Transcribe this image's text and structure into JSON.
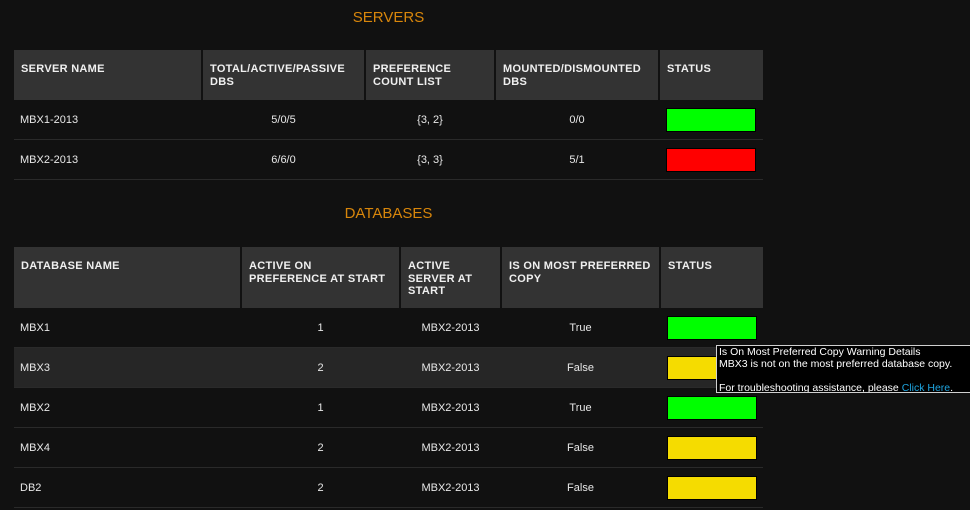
{
  "colors": {
    "accent": "#d8860b",
    "status_green": "#00ff00",
    "status_red": "#ff0000",
    "status_yellow": "#f5dc00",
    "link": "#1ea5e0"
  },
  "servers": {
    "title": "SERVERS",
    "columns": [
      "SERVER NAME",
      "TOTAL/ACTIVE/PASSIVE DBS",
      "PREFERENCE COUNT LIST",
      "MOUNTED/DISMOUNTED DBS",
      "STATUS"
    ],
    "rows": [
      {
        "name": "MBX1-2013",
        "total_active_passive": "5/0/5",
        "preference_count": "{3, 2}",
        "mounted_dismounted": "0/0",
        "status": "green"
      },
      {
        "name": "MBX2-2013",
        "total_active_passive": "6/6/0",
        "preference_count": "{3, 3}",
        "mounted_dismounted": "5/1",
        "status": "red"
      }
    ]
  },
  "databases": {
    "title": "DATABASES",
    "columns": [
      "DATABASE NAME",
      "ACTIVE ON PREFERENCE AT START",
      "ACTIVE SERVER AT START",
      "IS ON MOST PREFERRED COPY",
      "STATUS"
    ],
    "rows": [
      {
        "name": "MBX1",
        "active_on_preference": "1",
        "active_server": "MBX2-2013",
        "on_most_preferred": "True",
        "status": "green"
      },
      {
        "name": "MBX3",
        "active_on_preference": "2",
        "active_server": "MBX2-2013",
        "on_most_preferred": "False",
        "status": "yellow"
      },
      {
        "name": "MBX2",
        "active_on_preference": "1",
        "active_server": "MBX2-2013",
        "on_most_preferred": "True",
        "status": "green"
      },
      {
        "name": "MBX4",
        "active_on_preference": "2",
        "active_server": "MBX2-2013",
        "on_most_preferred": "False",
        "status": "yellow"
      },
      {
        "name": "DB2",
        "active_on_preference": "2",
        "active_server": "MBX2-2013",
        "on_most_preferred": "False",
        "status": "yellow"
      }
    ]
  },
  "tooltip": {
    "title": "Is On Most Preferred Copy Warning Details",
    "message": "MBX3 is not on the most preferred database copy.",
    "help_prefix": "For troubleshooting assistance, please ",
    "help_link": "Click Here",
    "help_suffix": "."
  }
}
